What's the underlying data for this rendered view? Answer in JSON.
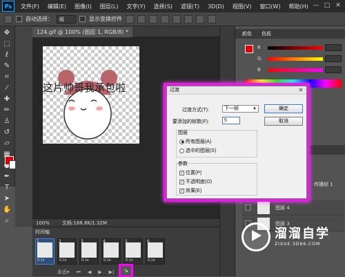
{
  "menubar": {
    "logo": "Ps",
    "items": [
      "文件(F)",
      "编辑(E)",
      "图像(I)",
      "图层(L)",
      "文字(Y)",
      "选择(S)",
      "滤镜(T)",
      "3D(D)",
      "视图(V)",
      "窗口(W)",
      "帮助(H)"
    ],
    "win_min": "—",
    "win_max": "□",
    "win_close": "✕"
  },
  "options": {
    "auto_select": "自动选择：",
    "group_value": "组",
    "show_transform": "显示变换控件"
  },
  "document": {
    "tab_label": "124.gif @ 100% (图层 1, RGB/8) *",
    "caption": "这片帅哥我承包啦",
    "zoom": "100%",
    "doc_size": "文档:168.8K/1.32M"
  },
  "timeline": {
    "title": "时间轴",
    "frames": [
      {
        "num": "1",
        "delay": "0.1▾"
      },
      {
        "num": "2",
        "delay": "0.1▾"
      },
      {
        "num": "3",
        "delay": "0.1▾"
      },
      {
        "num": "4",
        "delay": "0.1▾"
      },
      {
        "num": "5",
        "delay": "0.1▾"
      },
      {
        "num": "6",
        "delay": "0.1▾"
      }
    ],
    "loop": "永远▾",
    "controls": [
      "⏮",
      "◀",
      "▶",
      "▶|"
    ],
    "tween_icon": "↘"
  },
  "color_panel": {
    "tab1": "颜色",
    "tab2": "色板",
    "labels": [
      "R",
      "G",
      "B"
    ],
    "values": [
      "",
      "",
      ""
    ]
  },
  "layers_panel": {
    "fill_label": "填充",
    "unify_label": "传播帧 1",
    "rows": [
      {
        "name": "图层 4"
      },
      {
        "name": "图层 3"
      }
    ]
  },
  "dialog": {
    "title": "过渡",
    "tween_with_label": "过渡方式(T):",
    "tween_with_value": "下一帧",
    "frames_to_add_label": "要添加的帧数(F):",
    "frames_to_add_value": "5",
    "ok": "确定",
    "cancel": "取消",
    "layers_group": "图层",
    "all_layers": "所有图层(A)",
    "selected_layers": "选中的图层(S)",
    "params_group": "参数",
    "position": "位置(P)",
    "opacity": "不透明度(O)",
    "effects": "效果(E)"
  },
  "watermark": {
    "text": "溜溜自学",
    "sub": "ZIXUE.3D66.COM"
  },
  "colors": {
    "foreground": "#e00000",
    "highlight": "#e020e0"
  }
}
